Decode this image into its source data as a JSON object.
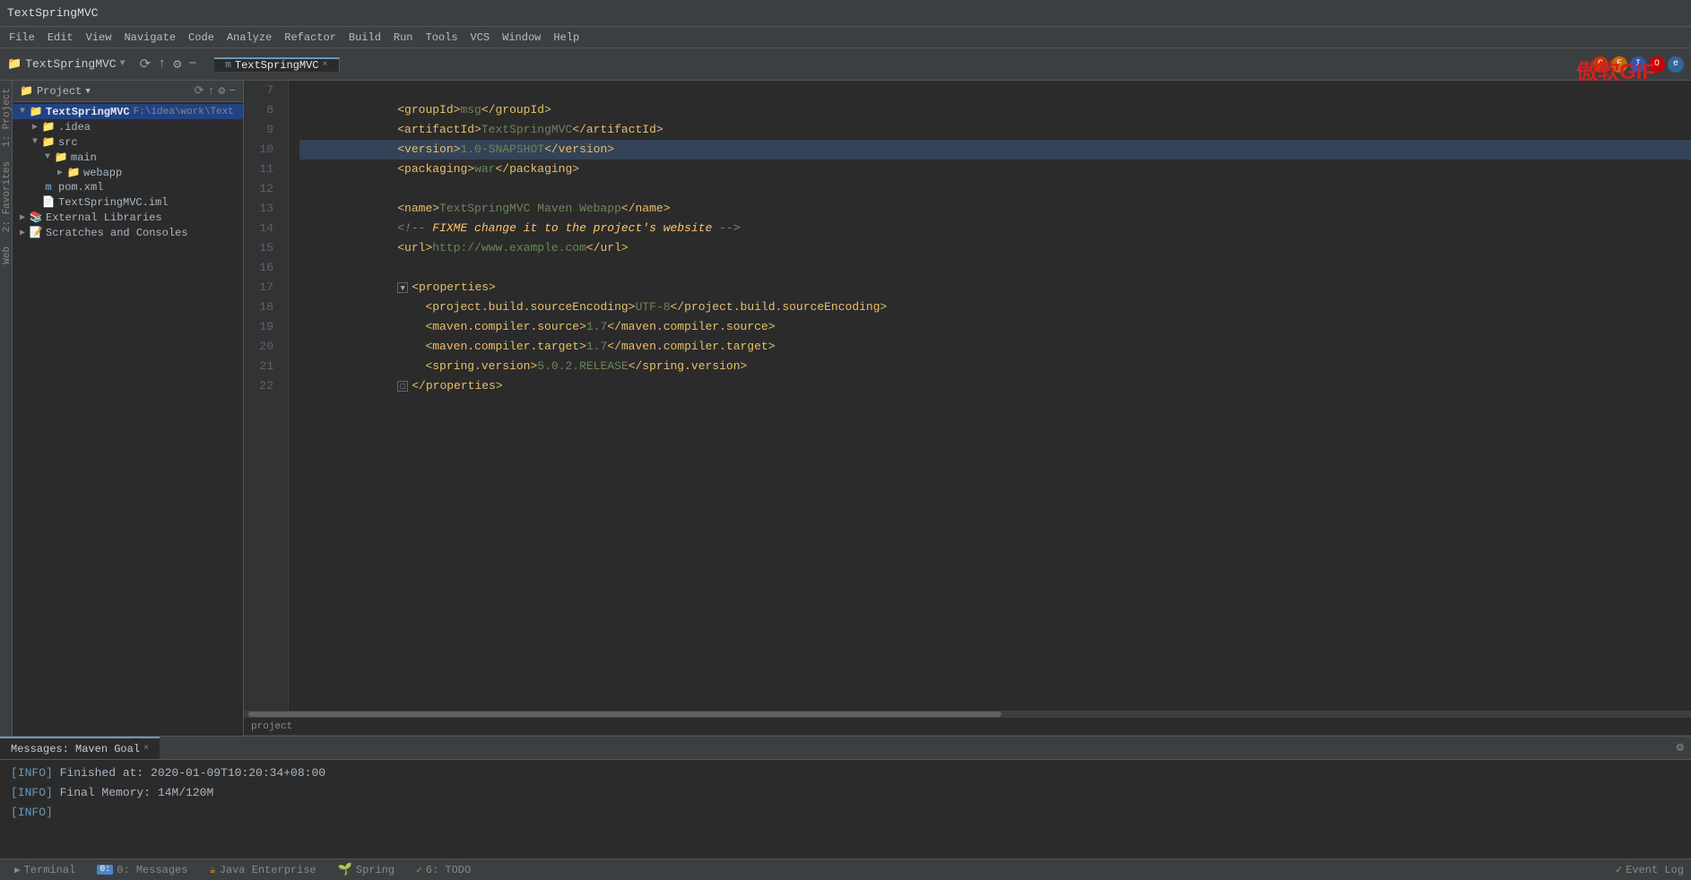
{
  "titlebar": {
    "title": "TextSpringMVC"
  },
  "menubar": {
    "items": [
      "File",
      "Edit",
      "View",
      "Navigate",
      "Code",
      "Analyze",
      "Refactor",
      "Build",
      "Run",
      "Tools",
      "VCS",
      "Window",
      "Help"
    ]
  },
  "toolbar": {
    "project_name": "TextSpringMVC",
    "dropdown_arrow": "▼"
  },
  "project_panel": {
    "header": "Project",
    "tree": [
      {
        "id": "root",
        "label": "TextSpringMVC",
        "path": "F:\\idea\\work\\Text",
        "indent": 0,
        "arrow": "▼",
        "icon": "📁",
        "bold": true,
        "selected": true
      },
      {
        "id": "idea",
        "label": ".idea",
        "indent": 1,
        "arrow": "▶",
        "icon": "📁"
      },
      {
        "id": "src",
        "label": "src",
        "indent": 1,
        "arrow": "▼",
        "icon": "📁"
      },
      {
        "id": "main",
        "label": "main",
        "indent": 2,
        "arrow": "▼",
        "icon": "📁"
      },
      {
        "id": "webapp",
        "label": "webapp",
        "indent": 3,
        "arrow": "▶",
        "icon": "📁"
      },
      {
        "id": "pom",
        "label": "pom.xml",
        "indent": 2,
        "arrow": "",
        "icon": "m"
      },
      {
        "id": "iml",
        "label": "TextSpringMVC.iml",
        "indent": 2,
        "arrow": "",
        "icon": "📄"
      },
      {
        "id": "extlib",
        "label": "External Libraries",
        "indent": 0,
        "arrow": "▶",
        "icon": "📚"
      },
      {
        "id": "scratches",
        "label": "Scratches and Consoles",
        "indent": 0,
        "arrow": "▶",
        "icon": "📝"
      }
    ]
  },
  "editor": {
    "tab": {
      "icon": "m",
      "label": "TextSpringMVC",
      "close": "×"
    },
    "lines": [
      {
        "num": 7,
        "content": "    <groupId>msg</groupId>",
        "type": "normal"
      },
      {
        "num": 8,
        "content": "    <artifactId>TextSpringMVC</artifactId>",
        "type": "normal"
      },
      {
        "num": 9,
        "content": "    <version>1.0-SNAPSHOT</version>",
        "type": "normal"
      },
      {
        "num": 10,
        "content": "    <packaging>war</packaging>",
        "type": "highlighted"
      },
      {
        "num": 11,
        "content": "",
        "type": "normal"
      },
      {
        "num": 12,
        "content": "    <name>TextSpringMVC Maven Webapp</name>",
        "type": "normal"
      },
      {
        "num": 13,
        "content": "    <!-- FIXME change it to the project's website -->",
        "type": "comment"
      },
      {
        "num": 14,
        "content": "    <url>http://www.example.com</url>",
        "type": "normal"
      },
      {
        "num": 15,
        "content": "",
        "type": "normal"
      },
      {
        "num": 16,
        "content": "    <properties>",
        "type": "foldable"
      },
      {
        "num": 17,
        "content": "        <project.build.sourceEncoding>UTF-8</project.build.sourceEncoding>",
        "type": "normal"
      },
      {
        "num": 18,
        "content": "        <maven.compiler.source>1.7</maven.compiler.source>",
        "type": "normal"
      },
      {
        "num": 19,
        "content": "        <maven.compiler.target>1.7</maven.compiler.target>",
        "type": "normal"
      },
      {
        "num": 20,
        "content": "        <spring.version>5.0.2.RELEASE</spring.version>",
        "type": "normal"
      },
      {
        "num": 21,
        "content": "    </properties>",
        "type": "foldable-end"
      },
      {
        "num": 22,
        "content": "",
        "type": "normal"
      }
    ]
  },
  "breadcrumb": {
    "label": "project"
  },
  "bottom_panel": {
    "tabs": [
      {
        "label": "Messages: Maven Goal",
        "close": "×",
        "active": true
      }
    ],
    "console_lines": [
      "[INFO] Finished at: 2020-01-09T10:20:34+08:00",
      "[INFO] Final Memory: 14M/120M",
      "[INFO]"
    ]
  },
  "statusbar": {
    "tabs": [
      {
        "icon": "▶",
        "label": "Terminal"
      },
      {
        "icon": "0:",
        "label": "0: Messages"
      },
      {
        "icon": "☕",
        "label": "Java Enterprise"
      },
      {
        "icon": "🌱",
        "label": "Spring"
      },
      {
        "icon": "✓",
        "label": "6: TODO"
      }
    ],
    "right": {
      "label": "Event Log"
    }
  },
  "side_tabs": {
    "items": [
      "1: Project",
      "2: Favorites",
      "Web"
    ]
  },
  "watermark": "傲软GIF",
  "browser_icons": [
    {
      "color": "#cc3300",
      "label": "chrome"
    },
    {
      "color": "#cc8800",
      "label": "firefox"
    },
    {
      "color": "#3366cc",
      "label": "ie-blue"
    },
    {
      "color": "#cc0000",
      "label": "opera"
    },
    {
      "color": "#336699",
      "label": "ie-edge"
    }
  ]
}
